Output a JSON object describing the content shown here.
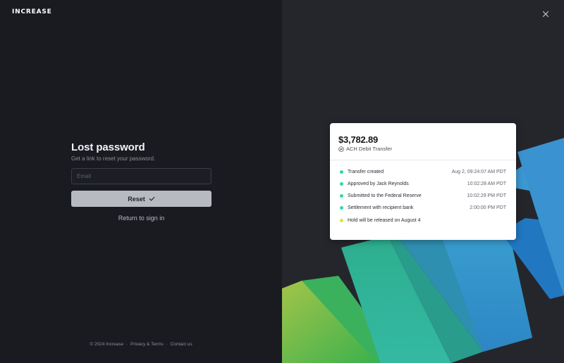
{
  "brand": {
    "logo": "INCREASE"
  },
  "form": {
    "title": "Lost password",
    "subtitle": "Get a link to reset your password.",
    "email_placeholder": "Email",
    "reset_label": "Reset",
    "return_label": "Return to sign in"
  },
  "footer": {
    "copyright": "© 2024 Increase",
    "separator": "·",
    "privacy": "Privacy & Terms",
    "contact": "Contact us"
  },
  "card": {
    "amount": "$3,782.89",
    "type": "ACH Debit Transfer",
    "events": [
      {
        "label": "Transfer created",
        "time": "Aug 2, 09:24:07 AM PDT",
        "color": "#2fd9a7"
      },
      {
        "label": "Approved by Jack Reynolds",
        "time": "10:02:28 AM PDT",
        "color": "#2fd9a7"
      },
      {
        "label": "Submitted to the Federal Reserve",
        "time": "10:02:29 PM PDT",
        "color": "#2fd9a7"
      },
      {
        "label": "Settlement with recipient bank",
        "time": "2:00:00 PM PDT",
        "color": "#2fd9a7"
      },
      {
        "label": "Hold will be released on August 4",
        "time": "",
        "color": "#d8e83a"
      }
    ]
  },
  "colors": {
    "left_bg": "#1a1b21",
    "right_bg": "#25262c",
    "button_bg": "#b8bac2",
    "success": "#2fd9a7",
    "pending": "#d8e83a"
  },
  "icons": {
    "close": "close-icon",
    "reset": "checkmark-icon",
    "transfer": "ach-transfer-icon"
  }
}
